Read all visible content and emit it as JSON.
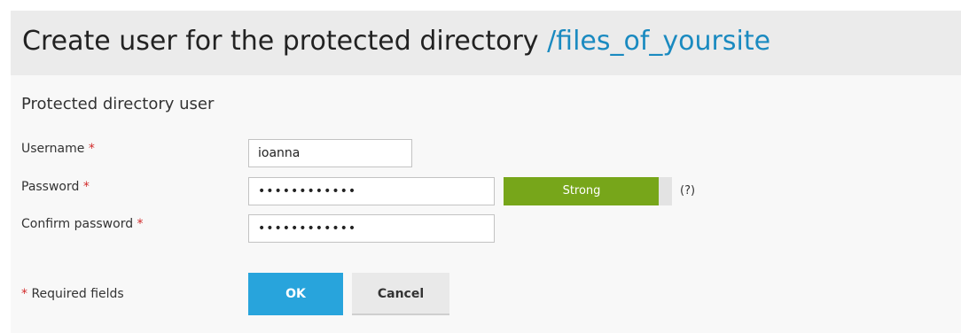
{
  "header": {
    "title_prefix": "Create user for the protected directory ",
    "title_link": "/files_of_yoursite"
  },
  "form": {
    "section_title": "Protected directory user",
    "required_marker": "*",
    "username": {
      "label": "Username ",
      "value": "ioanna"
    },
    "password": {
      "label": "Password ",
      "masked_value": "••••••••••••"
    },
    "confirm_password": {
      "label": "Confirm password ",
      "masked_value": "••••••••••••"
    },
    "strength": {
      "label": "Strong",
      "level_fraction": 0.92,
      "fill_color": "#77a61a"
    },
    "help_link": "(?)",
    "required_note": " Required fields"
  },
  "buttons": {
    "ok_label": "OK",
    "cancel_label": "Cancel",
    "ok_color": "#28a4dc"
  }
}
